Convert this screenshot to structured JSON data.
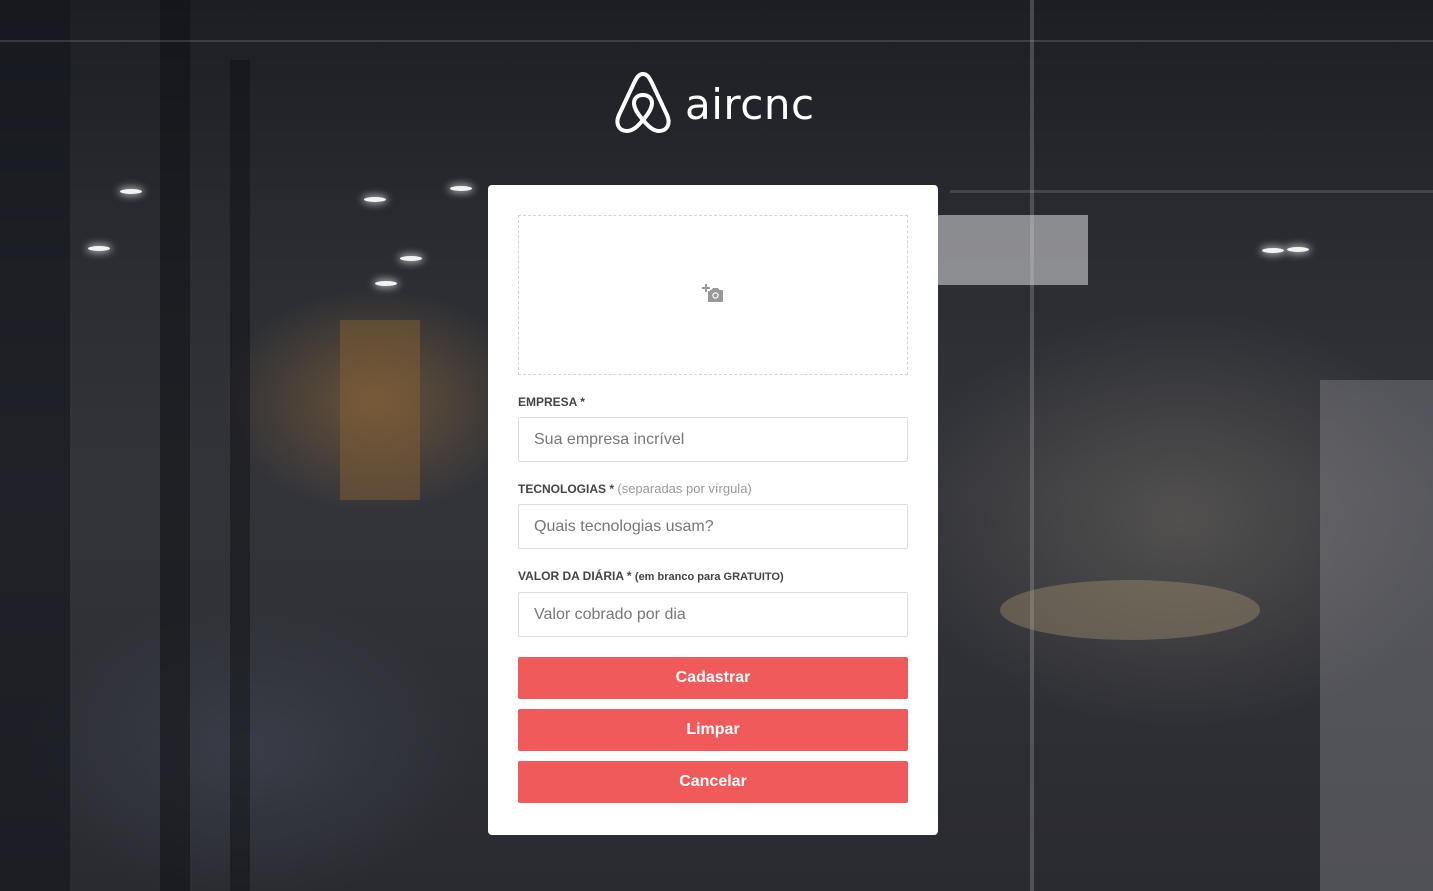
{
  "app": {
    "logo_text": "aircnc",
    "brand_color": "#f05a5b",
    "logo_icon": "airbnb-logo-icon"
  },
  "form": {
    "thumbnail": {
      "icon": "camera-add-icon"
    },
    "company": {
      "label": "EMPRESA *",
      "placeholder": "Sua empresa incrível"
    },
    "techs": {
      "label": "TECNOLOGIAS *",
      "hint": "(separadas por vírgula)",
      "placeholder": "Quais tecnologias usam?"
    },
    "price": {
      "label": "VALOR DA DIÁRIA *",
      "hint": "(em branco para GRATUITO)",
      "placeholder": "Valor cobrado por dia"
    },
    "buttons": {
      "submit": "Cadastrar",
      "clear": "Limpar",
      "cancel": "Cancelar"
    }
  }
}
